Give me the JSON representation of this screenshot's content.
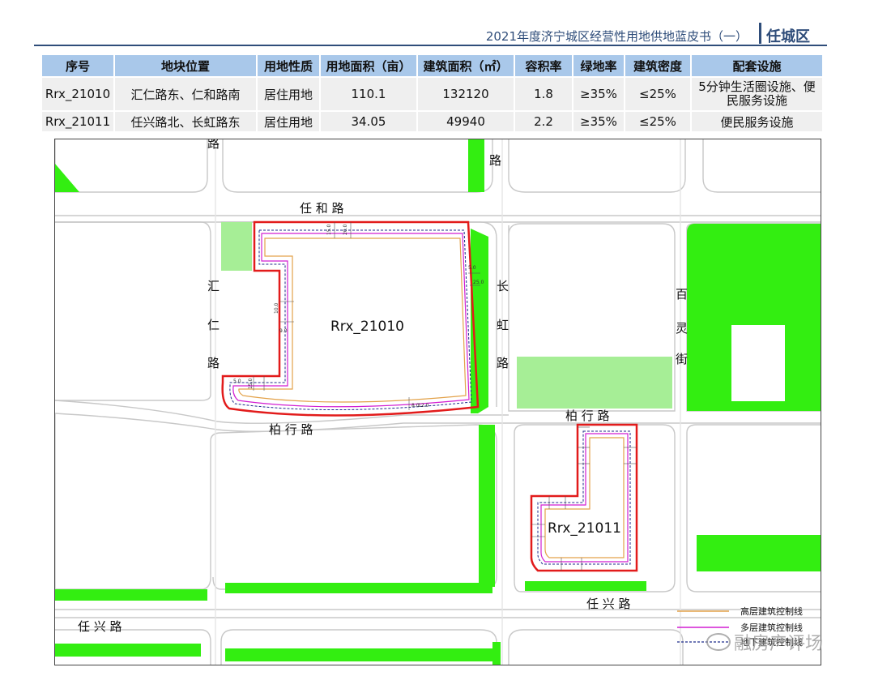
{
  "header": {
    "title": "2021年度济宁城区经营性用地供地蓝皮书（一）",
    "district": "任城区"
  },
  "table": {
    "columns": [
      "序号",
      "地块位置",
      "用地性质",
      "用地面积（亩）",
      "建筑面积（㎡）",
      "容积率",
      "绿地率",
      "建筑密度",
      "配套设施"
    ],
    "rows": [
      {
        "id": "Rrx_21010",
        "location": "汇仁路东、仁和路南",
        "use": "居住用地",
        "area_mu": "110.1",
        "floor_area": "132120",
        "far": "1.8",
        "green": "≥35%",
        "density": "≤25%",
        "facilities": "5分钟生活圈设施、便民服务设施"
      },
      {
        "id": "Rrx_21011",
        "location": "任兴路北、长虹路东",
        "use": "居住用地",
        "area_mu": "34.05",
        "floor_area": "49940",
        "far": "2.2",
        "green": "≥35%",
        "density": "≤25%",
        "facilities": "便民服务设施"
      }
    ]
  },
  "map": {
    "roads": {
      "renhe": "任 和 路",
      "huiren_1": "汇",
      "huiren_2": "仁",
      "huiren_3": "路",
      "top_left_fragment": "路",
      "top_mid_fragment": "路",
      "changhong_1": "长",
      "changhong_2": "虹",
      "changhong_3": "路",
      "baiyue_1": "百",
      "baiyue_2": "灵",
      "baiyue_3": "街",
      "baixing_left": "柏 行 路",
      "baixing_right": "柏 行 路",
      "renxing_left": "任 兴 路",
      "renxing_right": "任 兴 路"
    },
    "parcels": {
      "p1": "Rrx_21010",
      "p2": "Rrx_21011"
    },
    "dimensions": {
      "d1": "15.0",
      "d2": "20.0",
      "d3": "5.0",
      "d4": "25.0",
      "d5": "10.0",
      "d6": "8.0",
      "d7": "9.0",
      "d8": "5.0",
      "d9": "15.0",
      "d10": "12.0"
    },
    "legend": {
      "high_rise": "高层建筑控制线",
      "multi_story": "多层建筑控制线",
      "underground": "地下建筑控制线"
    },
    "colors": {
      "green": "#33ee11",
      "light_green": "#a6ee96",
      "road_line": "#c8c8c8",
      "red_boundary": "#e21b1b",
      "orange_line": "#e3a24a",
      "magenta_line": "#d21fd2",
      "navy_line": "#1c2a8a"
    }
  },
  "watermark": "融房产评场"
}
